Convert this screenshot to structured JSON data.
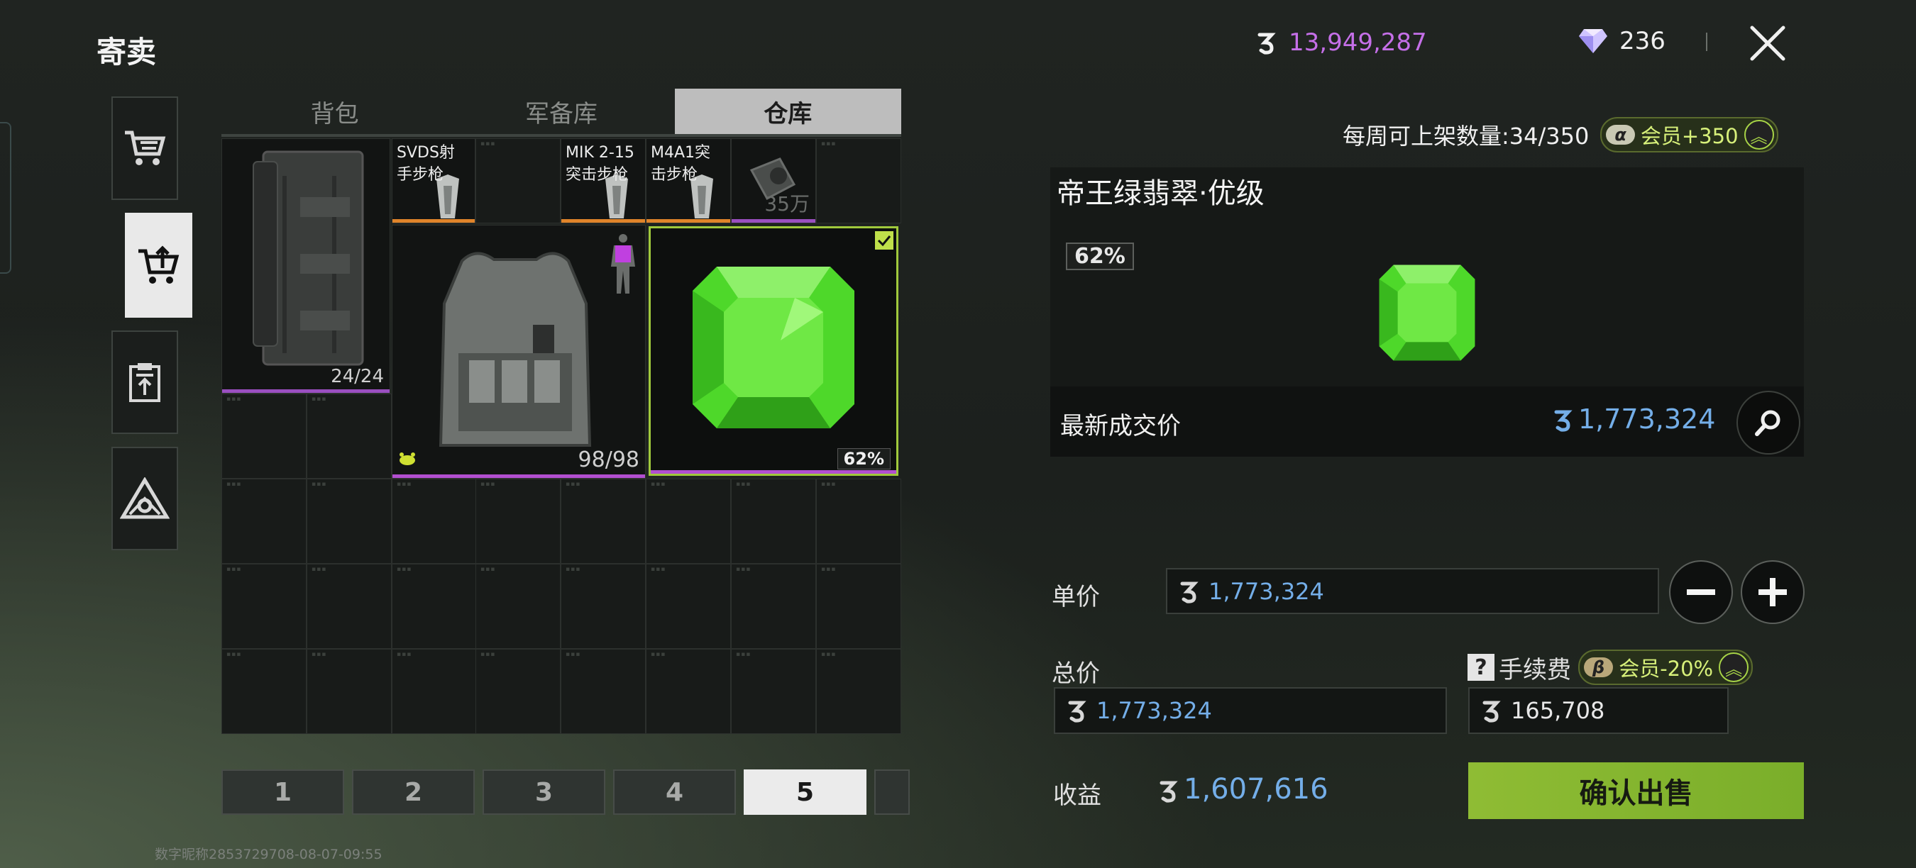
{
  "header": {
    "title": "寄卖",
    "coins": "13,949,287",
    "gems": "236"
  },
  "tabs": [
    {
      "label": "背包",
      "active": false
    },
    {
      "label": "军备库",
      "active": false
    },
    {
      "label": "仓库",
      "active": true
    }
  ],
  "side_nav": [
    "cart-icon",
    "sell-cart-icon",
    "clipboard-upload-icon",
    "triangle-logo-icon"
  ],
  "items": {
    "case": {
      "count": "24/24"
    },
    "svds": {
      "label1": "SVDS射",
      "label2": "手步枪"
    },
    "mik": {
      "label1": "MIK 2-15",
      "label2": "突击步枪"
    },
    "m4a1": {
      "label1": "M4A1突",
      "label2": "击步枪"
    },
    "scope": {
      "price": "35万"
    },
    "vest": {
      "count": "98/98"
    },
    "emerald": {
      "percent": "62%"
    }
  },
  "pagination": [
    "1",
    "2",
    "3",
    "4",
    "5"
  ],
  "active_page": "5",
  "footer_id": "数字昵称2853729708-08-07-09:55",
  "listing": {
    "weekly_label": "每周可上架数量:34/350",
    "weekly_badge_tag": "α",
    "weekly_badge_text": "会员+350",
    "item_name": "帝王绿翡翠·优级",
    "item_percent": "62%",
    "last_label": "最新成交价",
    "last_price": "1,773,324",
    "unit_label": "单价",
    "unit_price": "1,773,324",
    "total_label": "总价",
    "total_price": "1,773,324",
    "fee_q": "?",
    "fee_label": "手续费",
    "fee_badge_tag": "β",
    "fee_badge_text": "会员-20%",
    "fee_value": "165,708",
    "income_label": "收益",
    "income_value": "1,607,616",
    "confirm_label": "确认出售"
  },
  "colors": {
    "accent_green": "#8fbc34",
    "price_blue": "#74aee8",
    "coin_purple": "#c56fe8",
    "emerald": "#4ed82a"
  }
}
